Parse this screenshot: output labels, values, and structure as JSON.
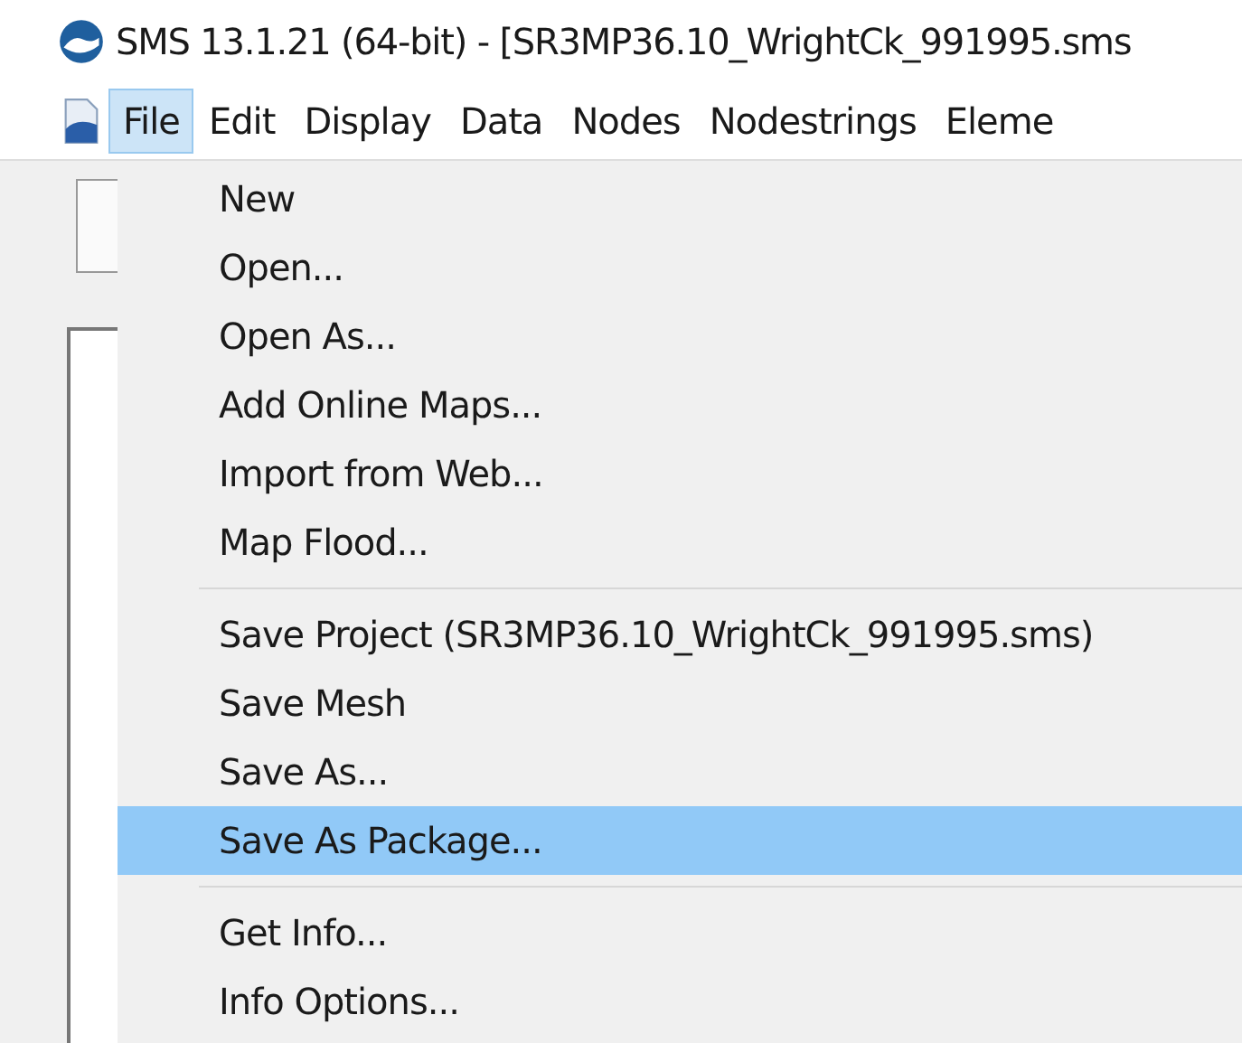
{
  "window": {
    "title": "SMS 13.1.21 (64-bit) - [SR3MP36.10_WrightCk_991995.sms"
  },
  "menu_bar": [
    {
      "label": "File",
      "selected": true
    },
    {
      "label": "Edit",
      "selected": false
    },
    {
      "label": "Display",
      "selected": false
    },
    {
      "label": "Data",
      "selected": false
    },
    {
      "label": "Nodes",
      "selected": false
    },
    {
      "label": "Nodestrings",
      "selected": false
    },
    {
      "label": "Eleme",
      "selected": false
    }
  ],
  "file_menu": [
    {
      "kind": "item",
      "label": "New",
      "selected": false
    },
    {
      "kind": "item",
      "label": "Open...",
      "selected": false
    },
    {
      "kind": "item",
      "label": "Open As...",
      "selected": false
    },
    {
      "kind": "item",
      "label": "Add Online Maps...",
      "selected": false
    },
    {
      "kind": "item",
      "label": "Import from Web...",
      "selected": false
    },
    {
      "kind": "item",
      "label": "Map Flood...",
      "selected": false
    },
    {
      "kind": "separator"
    },
    {
      "kind": "item",
      "label": "Save Project (SR3MP36.10_WrightCk_991995.sms)",
      "selected": false
    },
    {
      "kind": "item",
      "label": "Save Mesh",
      "selected": false
    },
    {
      "kind": "item",
      "label": "Save As...",
      "selected": false
    },
    {
      "kind": "item",
      "label": "Save As Package...",
      "selected": true
    },
    {
      "kind": "separator"
    },
    {
      "kind": "item",
      "label": "Get Info...",
      "selected": false
    },
    {
      "kind": "item",
      "label": "Info Options...",
      "selected": false
    }
  ]
}
